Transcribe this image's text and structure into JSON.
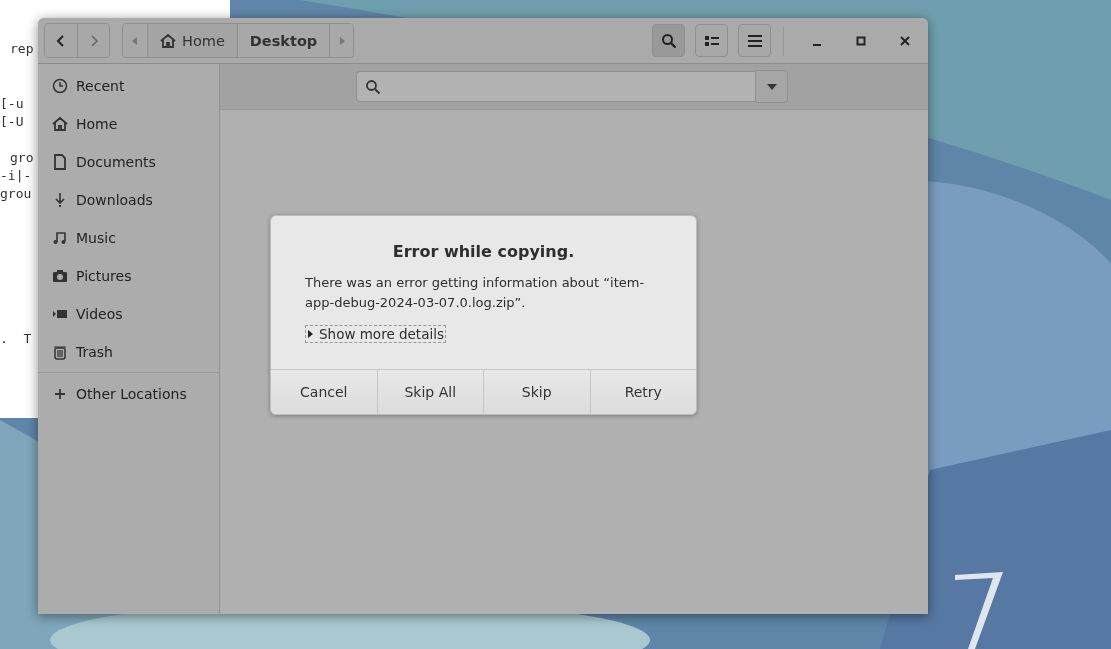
{
  "terminal": {
    "lines": [
      "rep",
      "[-u",
      "[-U",
      "gro",
      "-i|-",
      "grou",
      ".  T"
    ]
  },
  "file_manager": {
    "path_bar": [
      {
        "label": "Home",
        "kind": "home",
        "selected": false
      },
      {
        "label": "Desktop",
        "kind": "folder",
        "selected": true
      }
    ],
    "search_toggle": {
      "on": true
    },
    "sidebar": {
      "items": [
        {
          "label": "Recent",
          "kind": "recent",
          "selected": false
        },
        {
          "label": "Home",
          "kind": "home",
          "selected": false
        },
        {
          "label": "Documents",
          "kind": "documents",
          "selected": false
        },
        {
          "label": "Downloads",
          "kind": "downloads",
          "selected": false
        },
        {
          "label": "Music",
          "kind": "music",
          "selected": false
        },
        {
          "label": "Pictures",
          "kind": "pictures",
          "selected": false
        },
        {
          "label": "Videos",
          "kind": "videos",
          "selected": false
        },
        {
          "label": "Trash",
          "kind": "trash",
          "selected": false
        }
      ],
      "other": {
        "label": "Other Locations",
        "selected": false
      }
    }
  },
  "dialog": {
    "title": "Error while copying.",
    "message": "There was an error getting information about “item-app-debug-2024-03-07.0.log.zip”.",
    "details": {
      "label": "Show more details",
      "expanded": false
    },
    "buttons": [
      "Cancel",
      "Skip All",
      "Skip",
      "Retry"
    ]
  }
}
